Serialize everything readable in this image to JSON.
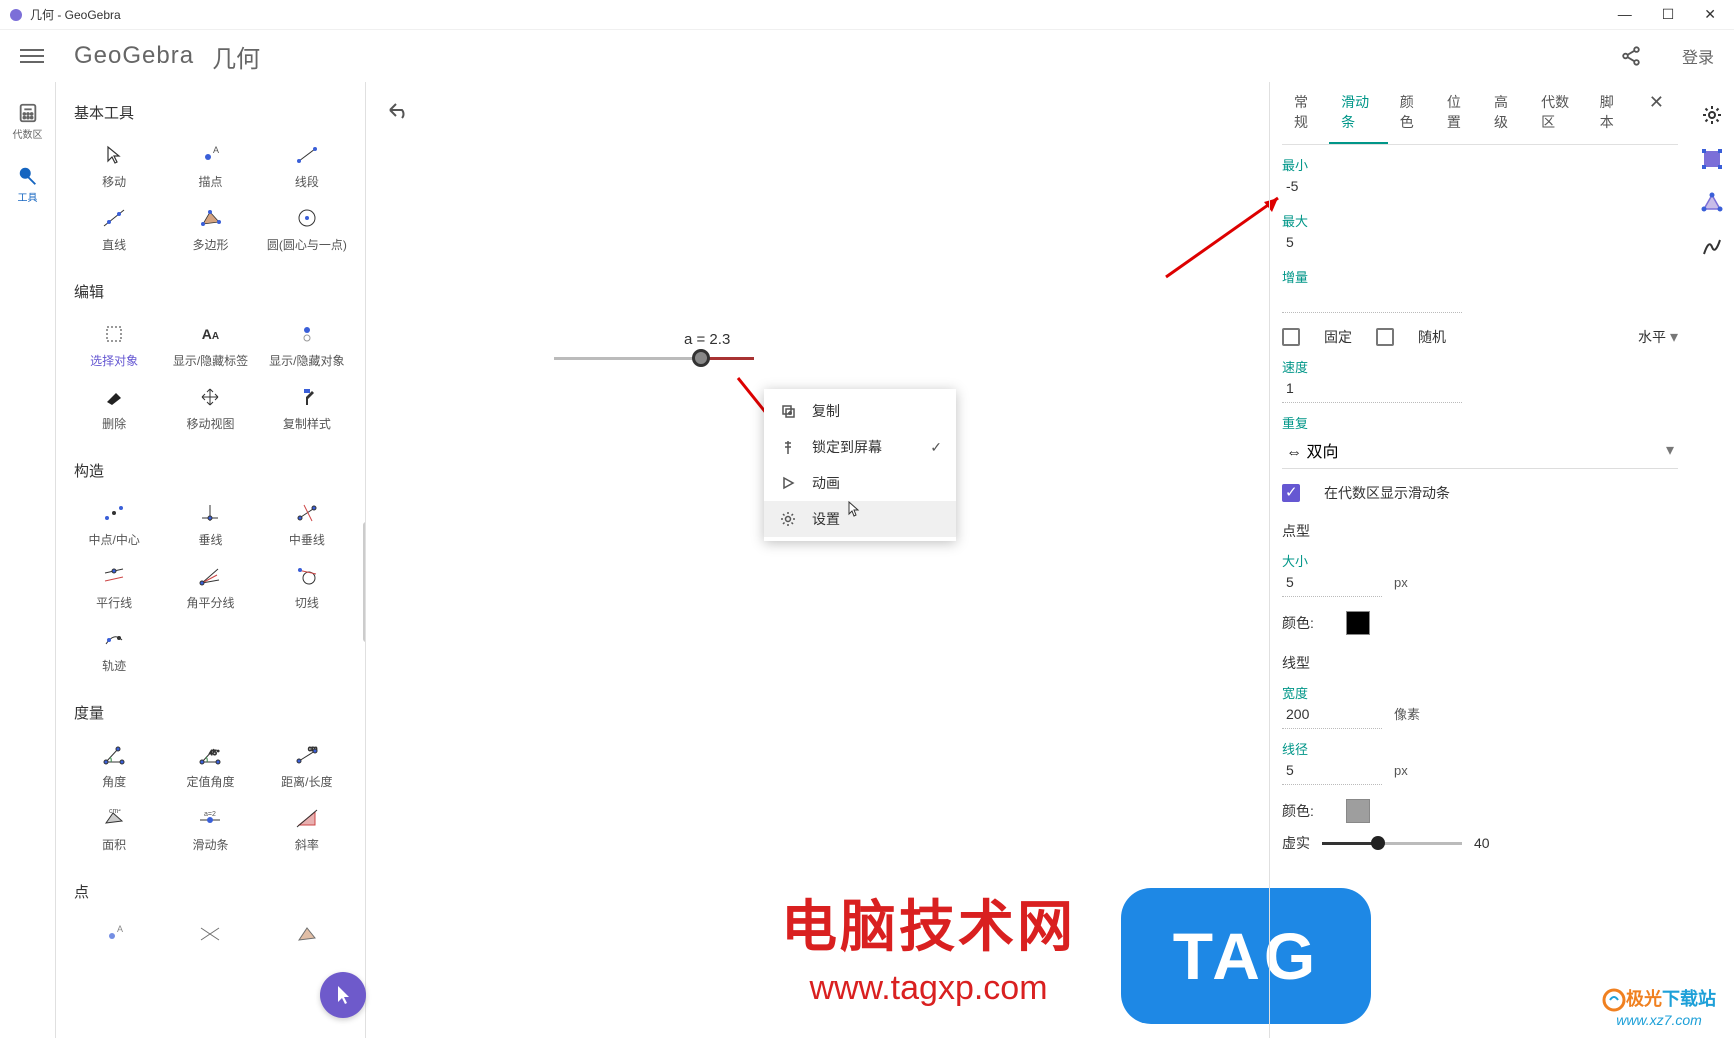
{
  "titlebar": {
    "text": "几何 - GeoGebra"
  },
  "header": {
    "logo": "GeoGebra",
    "title": "几何",
    "login": "登录"
  },
  "leftRail": {
    "algebra": "代数区",
    "tools": "工具"
  },
  "toolPanel": {
    "sections": {
      "basic": {
        "title": "基本工具",
        "items": [
          "移动",
          "描点",
          "线段",
          "直线",
          "多边形",
          "圆(圆心与一点)"
        ]
      },
      "edit": {
        "title": "编辑",
        "items": [
          "选择对象",
          "显示/隐藏标签",
          "显示/隐藏对象",
          "删除",
          "移动视图",
          "复制样式"
        ]
      },
      "construct": {
        "title": "构造",
        "items": [
          "中点/中心",
          "垂线",
          "中垂线",
          "平行线",
          "角平分线",
          "切线",
          "轨迹"
        ]
      },
      "measure": {
        "title": "度量",
        "items": [
          "角度",
          "定值角度",
          "距离/长度",
          "面积",
          "滑动条",
          "斜率"
        ]
      },
      "points": {
        "title": "点"
      }
    }
  },
  "canvas": {
    "sliderLabel": "a = 2.3"
  },
  "contextMenu": {
    "copy": "复制",
    "lockScreen": "锁定到屏幕",
    "animate": "动画",
    "settings": "设置"
  },
  "rightPanel": {
    "tabs": {
      "general": "常规",
      "slider": "滑动条",
      "color": "颜色",
      "position": "位置",
      "advanced": "高级",
      "algebra": "代数区",
      "script": "脚本"
    },
    "min": {
      "label": "最小",
      "value": "-5"
    },
    "max": {
      "label": "最大",
      "value": "5"
    },
    "increment": {
      "label": "增量",
      "value": ""
    },
    "fixed": "固定",
    "random": "随机",
    "orientation": "水平",
    "speed": {
      "label": "速度",
      "value": "1"
    },
    "repeat": {
      "label": "重复",
      "value": "⇔ 双向"
    },
    "showInAlgebra": "在代数区显示滑动条",
    "pointStyle": "点型",
    "size": {
      "label": "大小",
      "value": "5",
      "unit": "px"
    },
    "colorLabel": "颜色:",
    "pointColor": "#000000",
    "lineStyle": "线型",
    "width": {
      "label": "宽度",
      "value": "200",
      "unit": "像素"
    },
    "lineRadius": {
      "label": "线径",
      "value": "5",
      "unit": "px"
    },
    "lineColor": "#9e9e9e",
    "dashed": {
      "label": "虚实",
      "value": "40"
    }
  },
  "watermark": {
    "title": "电脑技术网",
    "url": "www.tagxp.com",
    "tag": "TAG"
  },
  "xzWatermark": {
    "logo1": "极光",
    "logo2": "下载站",
    "url": "www.xz7.com"
  }
}
